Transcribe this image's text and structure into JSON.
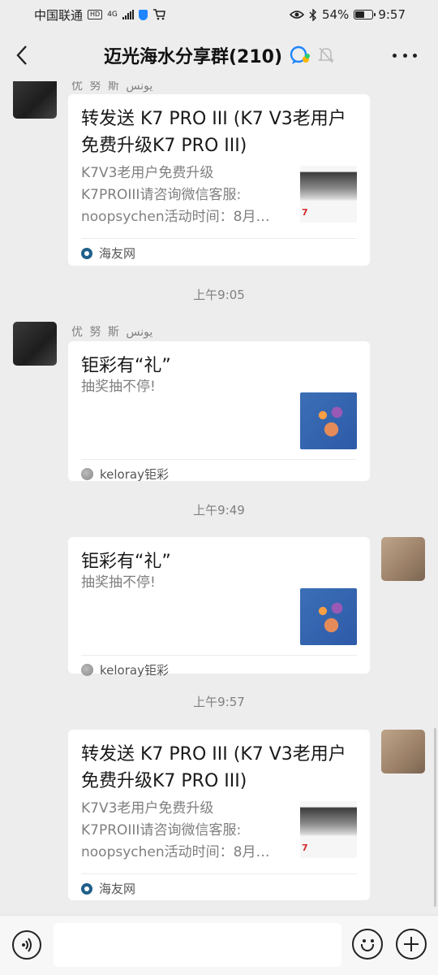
{
  "status_bar": {
    "carrier": "中国联通",
    "hd_tag": "HD",
    "network_tag": "4G",
    "battery": "54%",
    "time": "9:57",
    "battery_level": 0.54
  },
  "header": {
    "title": "迈光海水分享群(210)"
  },
  "messages": [
    {
      "sender": "优 努 斯  يونس",
      "card_title": "转发送 K7 PRO III (K7 V3老用户免费升级K7 PRO III)",
      "desc": "K7V3老用户免费升级\nK7PROIII请咨询微信客服:\nnoopsychen活动时间：8月…",
      "thumb_text": "7",
      "source": "海友网"
    },
    {
      "timestamp": "上午9:05"
    },
    {
      "sender": "优 努 斯  يونس",
      "card_title": "钜彩有“礼”",
      "desc": "抽奖抽不停!",
      "source": "keloray钜彩"
    },
    {
      "timestamp": "上午9:49"
    },
    {
      "card_title": "钜彩有“礼”",
      "desc": "抽奖抽不停!",
      "source": "keloray钜彩"
    },
    {
      "timestamp": "上午9:57"
    },
    {
      "card_title": "转发送 K7 PRO III (K7 V3老用户免费升级K7 PRO III)",
      "desc": "K7V3老用户免费升级\nK7PROIII请咨询微信客服:\nnoopsychen活动时间：8月…",
      "thumb_text": "7",
      "source": "海友网"
    }
  ],
  "colors": {
    "background": "#ededed",
    "card": "#ffffff",
    "input_bar": "#f7f7f7"
  },
  "icons": [
    "back-arrow-icon",
    "group-chat-icon",
    "mute-bell-icon",
    "more-icon",
    "voice-icon",
    "emoji-icon",
    "plus-icon"
  ]
}
